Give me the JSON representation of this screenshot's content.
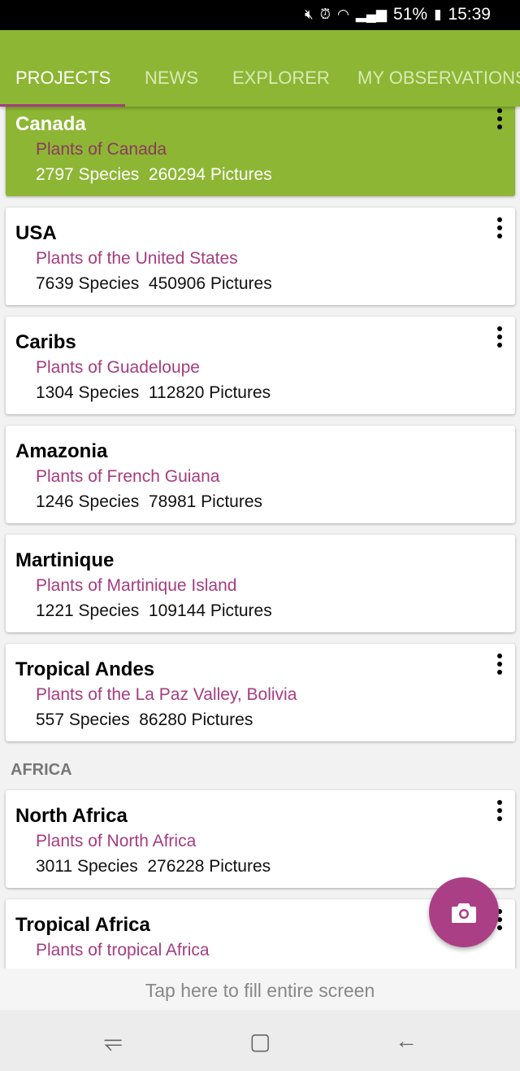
{
  "status_bar": {
    "battery": "51%",
    "time": "15:39",
    "icons": [
      "mute-icon",
      "alarm-icon",
      "wifi-icon",
      "signal-icon",
      "battery-icon"
    ]
  },
  "tabs": [
    {
      "label": "PROJECTS",
      "active": true
    },
    {
      "label": "NEWS"
    },
    {
      "label": "EXPLORER"
    },
    {
      "label": "MY OBSERVATIONS"
    }
  ],
  "projects": [
    {
      "title": "Canada",
      "subtitle": "Plants of Canada",
      "stats": "2797 Species  260294 Pictures",
      "selected": true,
      "menu": true
    },
    {
      "title": "USA",
      "subtitle": "Plants of the United States",
      "stats": "7639 Species  450906 Pictures",
      "menu": true
    },
    {
      "title": "Caribs",
      "subtitle": "Plants of Guadeloupe",
      "stats": "1304 Species  112820 Pictures",
      "menu": true
    },
    {
      "title": "Amazonia",
      "subtitle": "Plants of French Guiana",
      "stats": "1246 Species  78981 Pictures",
      "menu": false
    },
    {
      "title": "Martinique",
      "subtitle": "Plants of Martinique Island",
      "stats": "1221 Species  109144 Pictures",
      "menu": false
    },
    {
      "title": "Tropical Andes",
      "subtitle": "Plants of the La Paz Valley, Bolivia",
      "stats": "557 Species  86280 Pictures",
      "menu": true
    }
  ],
  "section_africa": "AFRICA",
  "africa": [
    {
      "title": "North Africa",
      "subtitle": "Plants of North Africa",
      "stats": "3011 Species  276228 Pictures",
      "menu": true
    },
    {
      "title": "Tropical Africa",
      "subtitle": "Plants of tropical Africa",
      "stats": "",
      "menu": true
    }
  ],
  "fab_icon": "camera-icon",
  "banner": "Tap here to fill entire screen",
  "colors": {
    "primary": "#8db634",
    "accent": "#ab3f85"
  }
}
